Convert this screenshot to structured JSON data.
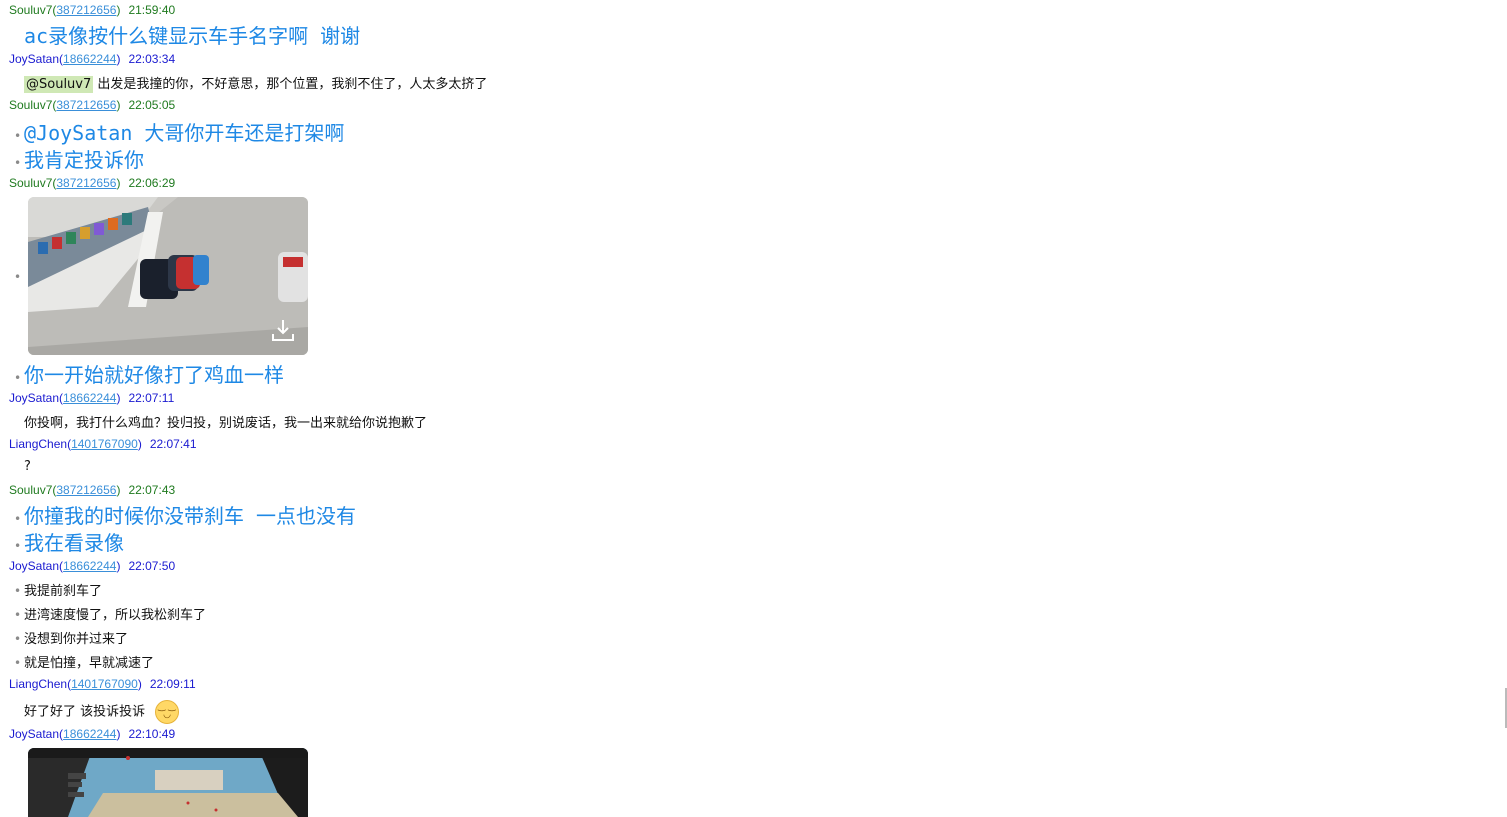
{
  "messages": [
    {
      "user": "Souluv7",
      "uid": "387212656",
      "time": "21:59:40",
      "lines": [
        "ac录像按什么键显示车手名字啊 谢谢"
      ]
    },
    {
      "user": "JoySatan",
      "uid": "18662244",
      "time": "22:03:34",
      "mention": "@Souluv7",
      "lines": [
        "出发是我撞的你，不好意思，那个位置，我刹不住了，人太多太挤了"
      ]
    },
    {
      "user": "Souluv7",
      "uid": "387212656",
      "time": "22:05:05",
      "lines": [
        "@JoySatan 大哥你开车还是打架啊",
        "我肯定投诉你"
      ]
    },
    {
      "user": "Souluv7",
      "uid": "387212656",
      "time": "22:06:29",
      "lines": [
        "你一开始就好像打了鸡血一样"
      ]
    },
    {
      "user": "JoySatan",
      "uid": "18662244",
      "time": "22:07:11",
      "lines": [
        "你投啊，我打什么鸡血？投归投，别说废话，我一出来就给你说抱歉了"
      ]
    },
    {
      "user": "LiangChen",
      "uid": "1401767090",
      "time": "22:07:41",
      "lines": [
        "?"
      ]
    },
    {
      "user": "Souluv7",
      "uid": "387212656",
      "time": "22:07:43",
      "lines": [
        "你撞我的时候你没带刹车 一点也没有",
        "我在看录像"
      ]
    },
    {
      "user": "JoySatan",
      "uid": "18662244",
      "time": "22:07:50",
      "lines": [
        "我提前刹车了",
        "进湾速度慢了，所以我松刹车了",
        "没想到你并过来了",
        "就是怕撞，早就减速了"
      ]
    },
    {
      "user": "LiangChen",
      "uid": "1401767090",
      "time": "22:09:11",
      "lines": [
        "好了好了  该投诉投诉"
      ]
    },
    {
      "user": "JoySatan",
      "uid": "18662244",
      "time": "22:10:49",
      "lines": []
    }
  ],
  "icons": {
    "download": "download-icon",
    "emoji": "smiling-face-icon"
  },
  "colors": {
    "souluv7": "#1f7a1f",
    "other": "#1a1ad0",
    "big_text": "#1e88e5",
    "uid_link": "#3a8fd9"
  }
}
